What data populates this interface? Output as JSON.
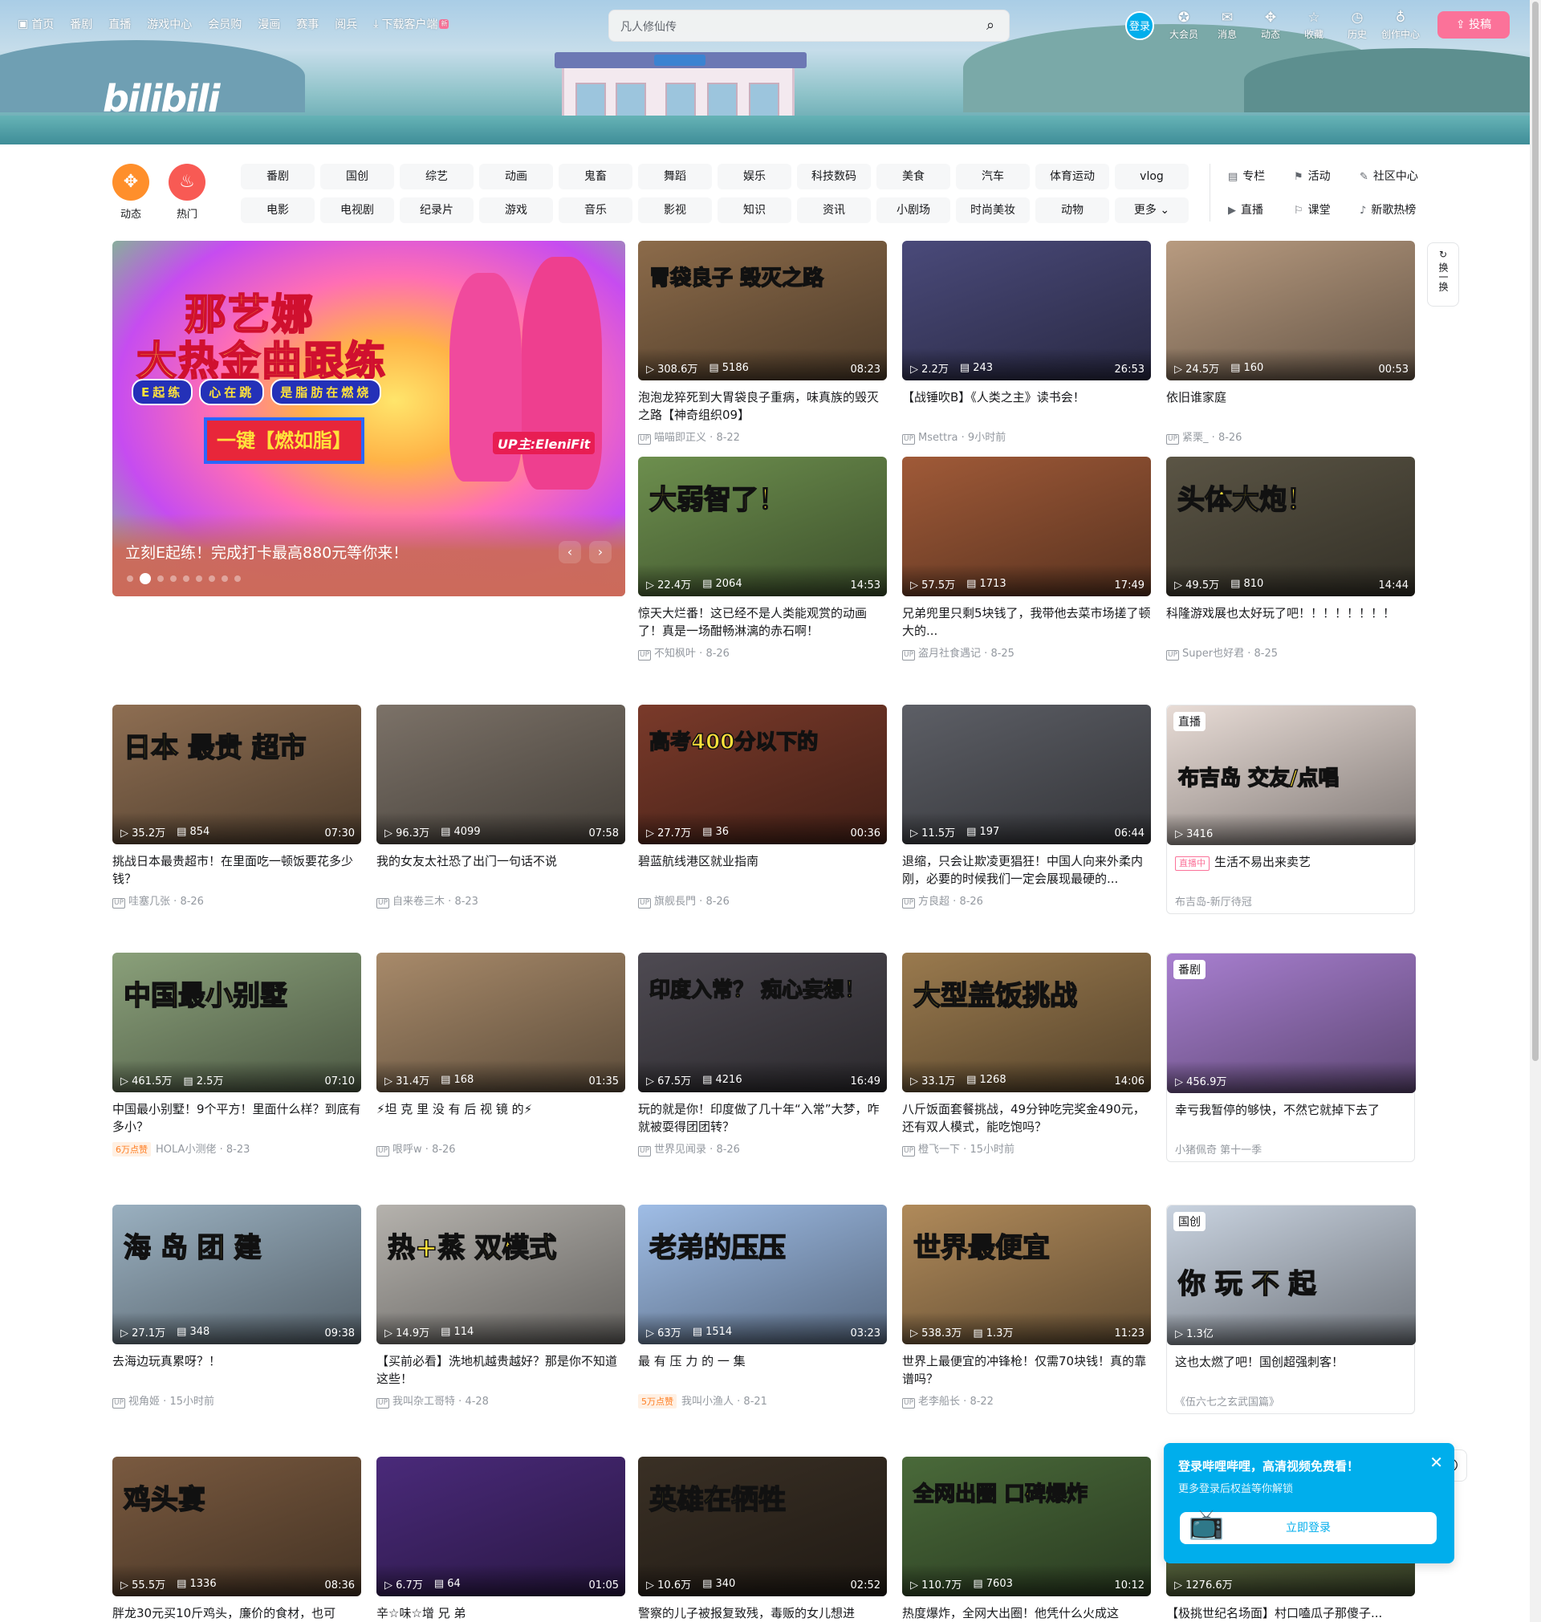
{
  "header": {
    "nav": [
      {
        "icon": "tv-icon",
        "label": "首页"
      },
      {
        "icon": "",
        "label": "番剧"
      },
      {
        "icon": "",
        "label": "直播"
      },
      {
        "icon": "",
        "label": "游戏中心"
      },
      {
        "icon": "",
        "label": "会员购"
      },
      {
        "icon": "",
        "label": "漫画"
      },
      {
        "icon": "",
        "label": "赛事"
      },
      {
        "icon": "",
        "label": "阅兵"
      },
      {
        "icon": "download-icon",
        "label": "下载客户端"
      }
    ],
    "new_tag": "新",
    "logo": "bilibili",
    "search_placeholder": "凡人修仙传",
    "login_label": "登录",
    "right_nav": [
      {
        "icon": "vip-icon",
        "label": "大会员"
      },
      {
        "icon": "message-icon",
        "label": "消息"
      },
      {
        "icon": "dynamic-icon",
        "label": "动态"
      },
      {
        "icon": "favorite-icon",
        "label": "收藏"
      },
      {
        "icon": "history-icon",
        "label": "历史"
      },
      {
        "icon": "creator-icon",
        "label": "创作中心"
      }
    ],
    "upload_label": "投稿"
  },
  "channels": {
    "dynamic_label": "动态",
    "hot_label": "热门",
    "row1": [
      "番剧",
      "国创",
      "综艺",
      "动画",
      "鬼畜",
      "舞蹈",
      "娱乐",
      "科技数码",
      "美食",
      "汽车",
      "体育运动",
      "vlog"
    ],
    "row2": [
      "电影",
      "电视剧",
      "纪录片",
      "游戏",
      "音乐",
      "影视",
      "知识",
      "资讯",
      "小剧场",
      "时尚美妆",
      "动物",
      "更多"
    ],
    "quick": [
      {
        "icon": "article-icon",
        "label": "专栏"
      },
      {
        "icon": "activity-icon",
        "label": "活动"
      },
      {
        "icon": "community-icon",
        "label": "社区中心"
      },
      {
        "icon": "live-icon",
        "label": "直播"
      },
      {
        "icon": "course-icon",
        "label": "课堂"
      },
      {
        "icon": "music-chart-icon",
        "label": "新歌热榜"
      }
    ]
  },
  "carousel": {
    "line1": "那艺娜",
    "line2": "大热金曲跟练",
    "tags": [
      "E起练",
      "心在跳",
      "是脂肪在燃烧"
    ],
    "button": "一键【燃如脂】",
    "up": "UP主:EleniFit",
    "caption": "立刻E起练！完成打卡最高880元等你来！",
    "dots": 9,
    "active_dot": 1
  },
  "refresh_label": "换一换",
  "videos": [
    {
      "title": "泡泡龙猝死到大胃袋良子重病，味真族的毁灭之路【神奇组织09】",
      "author": "喵喵即正义",
      "date": "8-22",
      "plays": "308.6万",
      "danmaku": "5186",
      "duration": "08:23",
      "overlay": "胃袋良子 毁灭之路",
      "color": "#8c6b4a"
    },
    {
      "title": "【战锤吹B】《人类之主》读书会！",
      "author": "Msettra",
      "date": "9小时前",
      "plays": "2.2万",
      "danmaku": "243",
      "duration": "26:53",
      "overlay": "",
      "color": "#4a4a7a"
    },
    {
      "title": "依旧谁家庭",
      "author": "紧栗_",
      "date": "8-26",
      "plays": "24.5万",
      "danmaku": "160",
      "duration": "00:53",
      "overlay": "",
      "color": "#b89b80"
    },
    {
      "title": "惊天大烂番！这已经不是人类能观赏的动画了！真是一场酣畅淋漓的赤石啊！",
      "author": "不知枫叶",
      "date": "8-26",
      "plays": "22.4万",
      "danmaku": "2064",
      "duration": "14:53",
      "overlay": "大弱智了！",
      "color": "#6d8f4e"
    },
    {
      "title": "兄弟兜里只剩5块钱了，我带他去菜市场搓了顿大的...",
      "author": "盗月社食遇记",
      "date": "8-25",
      "plays": "57.5万",
      "danmaku": "1713",
      "duration": "17:49",
      "overlay": "",
      "color": "#a05a38"
    },
    {
      "title": "科隆游戏展也太好玩了吧！！！！！！！！",
      "author": "Super也好君",
      "date": "8-25",
      "plays": "49.5万",
      "danmaku": "810",
      "duration": "14:44",
      "overlay": "头体大炮！",
      "color": "#5b5545"
    },
    {
      "title": "挑战日本最贵超市！在里面吃一顿饭要花多少钱？",
      "author": "哇塞几张",
      "date": "8-26",
      "plays": "35.2万",
      "danmaku": "854",
      "duration": "07:30",
      "overlay": "日本 最贵 超市",
      "color": "#8e6e52"
    },
    {
      "title": "我的女友太社恐了出门一句话不说",
      "author": "自来卷三木",
      "date": "8-23",
      "plays": "96.3万",
      "danmaku": "4099",
      "duration": "07:58",
      "overlay": "",
      "color": "#7c7268"
    },
    {
      "title": "碧蓝航线港区就业指南",
      "author": "旗舰長門",
      "date": "8-26",
      "plays": "27.7万",
      "danmaku": "36",
      "duration": "00:36",
      "overlay": "高考400分以下的",
      "color": "#7a3a2a"
    },
    {
      "title": "退缩，只会让欺凌更猖狂！中国人向来外柔内刚，必要的时候我们一定会展现最硬的...",
      "author": "方良超",
      "date": "8-26",
      "plays": "11.5万",
      "danmaku": "197",
      "duration": "06:44",
      "overlay": "",
      "color": "#5d5f66"
    },
    {
      "title": "生活不易出来卖艺",
      "author": "布吉岛-新厅待冠",
      "date": "",
      "plays": "3416",
      "danmaku": "",
      "duration": "",
      "overlay": "布吉岛 交友/点唱",
      "color": "#e8dcd6",
      "badge": "直播",
      "live": "直播中"
    },
    {
      "title": "中国最小别墅！9个平方！里面什么样？到底有多小？",
      "author": "HOLA小测佬",
      "date": "8-23",
      "plays": "461.5万",
      "danmaku": "2.5万",
      "duration": "07:10",
      "overlay": "中国最小别墅",
      "color": "#8aa07a",
      "likes": "6万点赞"
    },
    {
      "title": "⚡坦 克 里 没 有 后 视 镜 的⚡",
      "author": "哏呼w",
      "date": "8-26",
      "plays": "31.4万",
      "danmaku": "168",
      "duration": "01:35",
      "overlay": "",
      "color": "#a88a6a"
    },
    {
      "title": "玩的就是你！印度做了几十年“入常”大梦，咋就被耍得团团转？",
      "author": "世界见闻录",
      "date": "8-26",
      "plays": "67.5万",
      "danmaku": "4216",
      "duration": "16:49",
      "overlay": "印度入常？ 痴心妄想！",
      "color": "#4e4a52"
    },
    {
      "title": "八斤饭面套餐挑战，49分钟吃完奖金490元，还有双人模式，能吃饱吗？",
      "author": "橙飞一下",
      "date": "15小时前",
      "plays": "33.1万",
      "danmaku": "1268",
      "duration": "14:06",
      "overlay": "大型盖饭挑战",
      "color": "#9a7a4e"
    },
    {
      "title": "幸亏我暂停的够快，不然它就掉下去了",
      "author": "小猪佩奇 第十一季",
      "date": "",
      "plays": "456.9万",
      "danmaku": "",
      "duration": "",
      "overlay": "",
      "color": "#a87fd0",
      "badge": "番剧"
    },
    {
      "title": "去海边玩真累呀？！",
      "author": "视角姬",
      "date": "15小时前",
      "plays": "27.1万",
      "danmaku": "348",
      "duration": "09:38",
      "overlay": "海 岛 团 建",
      "color": "#9ab0c0"
    },
    {
      "title": "【买前必看】洗地机越贵越好？那是你不知道这些！",
      "author": "我叫杂工哥特",
      "date": "4-28",
      "plays": "14.9万",
      "danmaku": "114",
      "duration": "",
      "overlay": "热+蒸 双模式",
      "color": "#b5b2ad"
    },
    {
      "title": "最 有 压 力 的 一 集",
      "author": "我叫小渔人",
      "date": "8-21",
      "plays": "63万",
      "danmaku": "1514",
      "duration": "03:23",
      "overlay": "老弟的压压",
      "color": "#9fbde6",
      "likes": "5万点赞"
    },
    {
      "title": "世界上最便宜的冲锋枪！仅需70块钱！真的靠谱吗？",
      "author": "老李船长",
      "date": "8-22",
      "plays": "538.3万",
      "danmaku": "1.3万",
      "duration": "11:23",
      "overlay": "世界最便宜",
      "color": "#b08a5a"
    },
    {
      "title": "这也太燃了吧！国创超强刺客！",
      "author": "《伍六七之玄武国篇》",
      "date": "",
      "plays": "1.3亿",
      "danmaku": "",
      "duration": "",
      "overlay": "你 玩 不 起",
      "color": "#c9d3e0",
      "badge": "国创"
    },
    {
      "title": "胖龙30元买10斤鸡头，廉价的食材，也可",
      "author": "",
      "date": "",
      "plays": "55.5万",
      "danmaku": "1336",
      "duration": "08:36",
      "overlay": "鸡头宴",
      "color": "#7a5a40"
    },
    {
      "title": "辛☆味☆增 兄 弟",
      "author": "",
      "date": "",
      "plays": "6.7万",
      "danmaku": "64",
      "duration": "01:05",
      "overlay": "",
      "color": "#4a2a7a"
    },
    {
      "title": "警察的儿子被报复致残，毒贩的女儿想进",
      "author": "",
      "date": "",
      "plays": "10.6万",
      "danmaku": "340",
      "duration": "02:52",
      "overlay": "英雄在牺牲",
      "color": "#3a3025"
    },
    {
      "title": "热度爆炸，全网大出圈！他凭什么火成这",
      "author": "",
      "date": "",
      "plays": "110.7万",
      "danmaku": "7603",
      "duration": "10:12",
      "overlay": "全网出圈 口碑爆炸",
      "color": "#4a6a3a"
    },
    {
      "title": "【极挑世纪名场面】村口嗑瓜子那傻子...",
      "author": "",
      "date": "",
      "plays": "1276.6万",
      "danmaku": "",
      "duration": "",
      "overlay": "",
      "color": "#6a7a4a"
    }
  ],
  "login_popup": {
    "title": "登录哔哩哔哩，高清视频免费看！",
    "subtitle": "更多登录后权益等你解锁",
    "button": "立即登录"
  }
}
